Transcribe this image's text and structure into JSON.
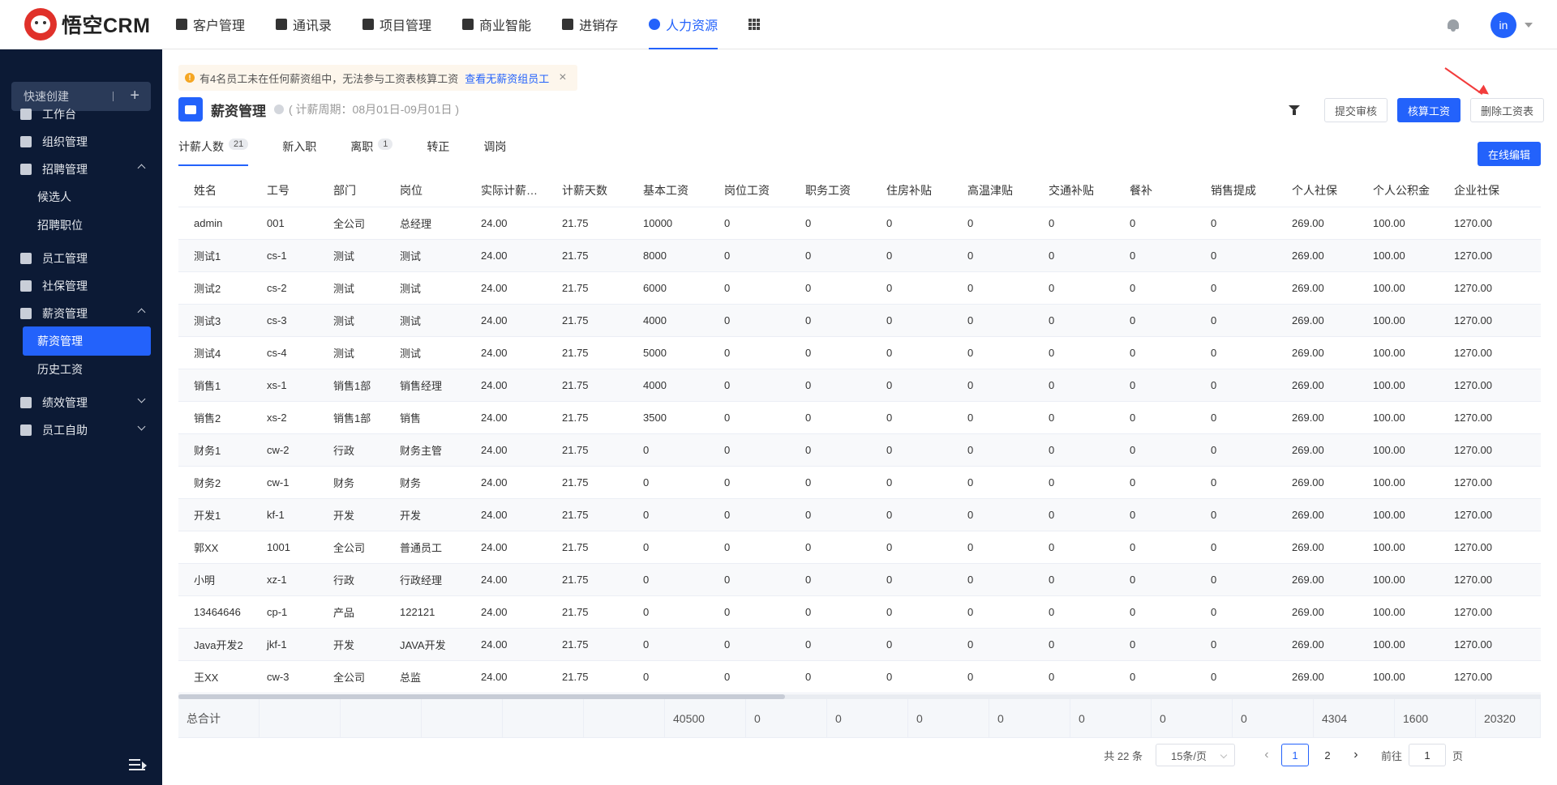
{
  "brand": {
    "name": "悟空CRM"
  },
  "nav": [
    {
      "label": "客户管理",
      "icon": "customer-icon",
      "active": false
    },
    {
      "label": "通讯录",
      "icon": "contacts-icon",
      "active": false
    },
    {
      "label": "项目管理",
      "icon": "project-icon",
      "active": false
    },
    {
      "label": "商业智能",
      "icon": "bi-icon",
      "active": false
    },
    {
      "label": "进销存",
      "icon": "inventory-icon",
      "active": false
    },
    {
      "label": "人力资源",
      "icon": "hr-icon",
      "active": true
    }
  ],
  "user": {
    "avatar_text": "in"
  },
  "sidebar": {
    "quick_create": "快速创建",
    "items": [
      {
        "label": "工作台",
        "icon": "dashboard-icon"
      },
      {
        "label": "组织管理",
        "icon": "org-icon"
      },
      {
        "label": "招聘管理",
        "icon": "recruit-icon"
      },
      {
        "label": "员工管理",
        "icon": "employee-icon"
      },
      {
        "label": "社保管理",
        "icon": "insurance-icon"
      },
      {
        "label": "薪资管理",
        "icon": "salary-icon"
      },
      {
        "label": "绩效管理",
        "icon": "performance-icon"
      },
      {
        "label": "员工自助",
        "icon": "self-service-icon"
      }
    ],
    "sub_recruit": [
      "候选人",
      "招聘职位"
    ],
    "sub_salary": [
      "薪资管理",
      "历史工资"
    ]
  },
  "alert": {
    "text": "有4名员工未在任何薪资组中，无法参与工资表核算工资",
    "link": "查看无薪资组员工"
  },
  "page": {
    "title": "薪资管理",
    "period": "( 计薪周期：08月01日-09月01日 )"
  },
  "actions": {
    "submit": "提交审核",
    "calculate": "核算工资",
    "delete": "删除工资表",
    "edit_online": "在线编辑"
  },
  "tabs": [
    {
      "label": "计薪人数",
      "badge": "21",
      "active": true
    },
    {
      "label": "新入职",
      "badge": "",
      "active": false
    },
    {
      "label": "离职",
      "badge": "1",
      "active": false
    },
    {
      "label": "转正",
      "badge": "",
      "active": false
    },
    {
      "label": "调岗",
      "badge": "",
      "active": false
    }
  ],
  "table": {
    "columns": [
      "姓名",
      "工号",
      "部门",
      "岗位",
      "实际计薪天数",
      "计薪天数",
      "基本工资",
      "岗位工资",
      "职务工资",
      "住房补贴",
      "高温津贴",
      "交通补贴",
      "餐补",
      "销售提成",
      "个人社保",
      "个人公积金",
      "企业社保"
    ],
    "rows": [
      [
        "admin",
        "001",
        "全公司",
        "总经理",
        "24.00",
        "21.75",
        "10000",
        "0",
        "0",
        "0",
        "0",
        "0",
        "0",
        "0",
        "269.00",
        "100.00",
        "1270.00"
      ],
      [
        "测试1",
        "cs-1",
        "测试",
        "测试",
        "24.00",
        "21.75",
        "8000",
        "0",
        "0",
        "0",
        "0",
        "0",
        "0",
        "0",
        "269.00",
        "100.00",
        "1270.00"
      ],
      [
        "测试2",
        "cs-2",
        "测试",
        "测试",
        "24.00",
        "21.75",
        "6000",
        "0",
        "0",
        "0",
        "0",
        "0",
        "0",
        "0",
        "269.00",
        "100.00",
        "1270.00"
      ],
      [
        "测试3",
        "cs-3",
        "测试",
        "测试",
        "24.00",
        "21.75",
        "4000",
        "0",
        "0",
        "0",
        "0",
        "0",
        "0",
        "0",
        "269.00",
        "100.00",
        "1270.00"
      ],
      [
        "测试4",
        "cs-4",
        "测试",
        "测试",
        "24.00",
        "21.75",
        "5000",
        "0",
        "0",
        "0",
        "0",
        "0",
        "0",
        "0",
        "269.00",
        "100.00",
        "1270.00"
      ],
      [
        "销售1",
        "xs-1",
        "销售1部",
        "销售经理",
        "24.00",
        "21.75",
        "4000",
        "0",
        "0",
        "0",
        "0",
        "0",
        "0",
        "0",
        "269.00",
        "100.00",
        "1270.00"
      ],
      [
        "销售2",
        "xs-2",
        "销售1部",
        "销售",
        "24.00",
        "21.75",
        "3500",
        "0",
        "0",
        "0",
        "0",
        "0",
        "0",
        "0",
        "269.00",
        "100.00",
        "1270.00"
      ],
      [
        "财务1",
        "cw-2",
        "行政",
        "财务主管",
        "24.00",
        "21.75",
        "0",
        "0",
        "0",
        "0",
        "0",
        "0",
        "0",
        "0",
        "269.00",
        "100.00",
        "1270.00"
      ],
      [
        "财务2",
        "cw-1",
        "财务",
        "财务",
        "24.00",
        "21.75",
        "0",
        "0",
        "0",
        "0",
        "0",
        "0",
        "0",
        "0",
        "269.00",
        "100.00",
        "1270.00"
      ],
      [
        "开发1",
        "kf-1",
        "开发",
        "开发",
        "24.00",
        "21.75",
        "0",
        "0",
        "0",
        "0",
        "0",
        "0",
        "0",
        "0",
        "269.00",
        "100.00",
        "1270.00"
      ],
      [
        "郭XX",
        "1001",
        "全公司",
        "普通员工",
        "24.00",
        "21.75",
        "0",
        "0",
        "0",
        "0",
        "0",
        "0",
        "0",
        "0",
        "269.00",
        "100.00",
        "1270.00"
      ],
      [
        "小明",
        "xz-1",
        "行政",
        "行政经理",
        "24.00",
        "21.75",
        "0",
        "0",
        "0",
        "0",
        "0",
        "0",
        "0",
        "0",
        "269.00",
        "100.00",
        "1270.00"
      ],
      [
        "13464646",
        "cp-1",
        "产品",
        "122121",
        "24.00",
        "21.75",
        "0",
        "0",
        "0",
        "0",
        "0",
        "0",
        "0",
        "0",
        "269.00",
        "100.00",
        "1270.00"
      ],
      [
        "Java开发2",
        "jkf-1",
        "开发",
        "JAVA开发",
        "24.00",
        "21.75",
        "0",
        "0",
        "0",
        "0",
        "0",
        "0",
        "0",
        "0",
        "269.00",
        "100.00",
        "1270.00"
      ],
      [
        "王XX",
        "cw-3",
        "全公司",
        "总监",
        "24.00",
        "21.75",
        "0",
        "0",
        "0",
        "0",
        "0",
        "0",
        "0",
        "0",
        "269.00",
        "100.00",
        "1270.00"
      ]
    ],
    "total_label": "总合计",
    "totals": [
      "",
      "",
      "",
      "",
      "",
      "40500",
      "0",
      "0",
      "0",
      "0",
      "0",
      "0",
      "0",
      "4304",
      "1600",
      "20320"
    ]
  },
  "pagination": {
    "total": "共 22 条",
    "page_size": "15条/页",
    "pages": [
      "1",
      "2"
    ],
    "current": "1",
    "goto_label": "前往",
    "goto_value": "1",
    "goto_suffix": "页"
  }
}
